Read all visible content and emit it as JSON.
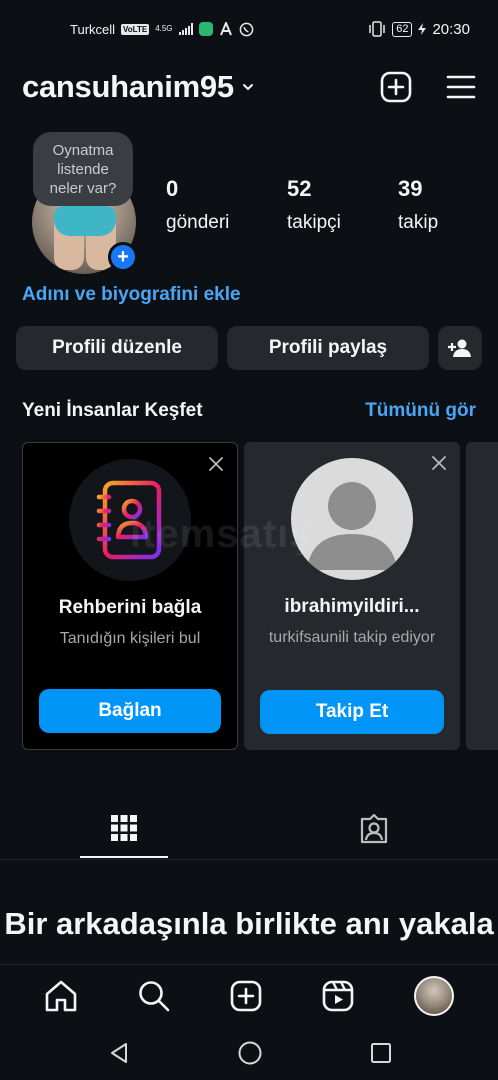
{
  "status_bar": {
    "carrier": "Turkcell",
    "volte": "VoLTE",
    "network": "4.5G",
    "battery": "62",
    "time": "20:30"
  },
  "header": {
    "username": "cansuhanim95"
  },
  "profile": {
    "note": "Oynatma listende neler var?",
    "stats": [
      {
        "value": "0",
        "label": "gönderi"
      },
      {
        "value": "52",
        "label": "takipçi"
      },
      {
        "value": "39",
        "label": "takip"
      }
    ],
    "bio_link": "Adını ve biyografini ekle",
    "edit_label": "Profili düzenle",
    "share_label": "Profili paylaş"
  },
  "discover": {
    "title": "Yeni İnsanlar Keşfet",
    "see_all": "Tümünü gör",
    "cards": [
      {
        "name": "Rehberini bağla",
        "subtitle": "Tanıdığın kişileri bul",
        "cta": "Bağlan",
        "icon": "contacts-book-icon"
      },
      {
        "name": "ibrahimyildiri...",
        "subtitle": "turkifsaunili takip ediyor",
        "cta": "Takip Et",
        "icon": "default-avatar-icon"
      }
    ]
  },
  "watermark": "itemsatış",
  "empty_state": {
    "title": "Bir arkadaşınla birlikte anı yakala"
  },
  "colors": {
    "background": "#0c1014",
    "accent": "#0095f6",
    "link": "#4aa6f5",
    "button": "#25292e"
  }
}
